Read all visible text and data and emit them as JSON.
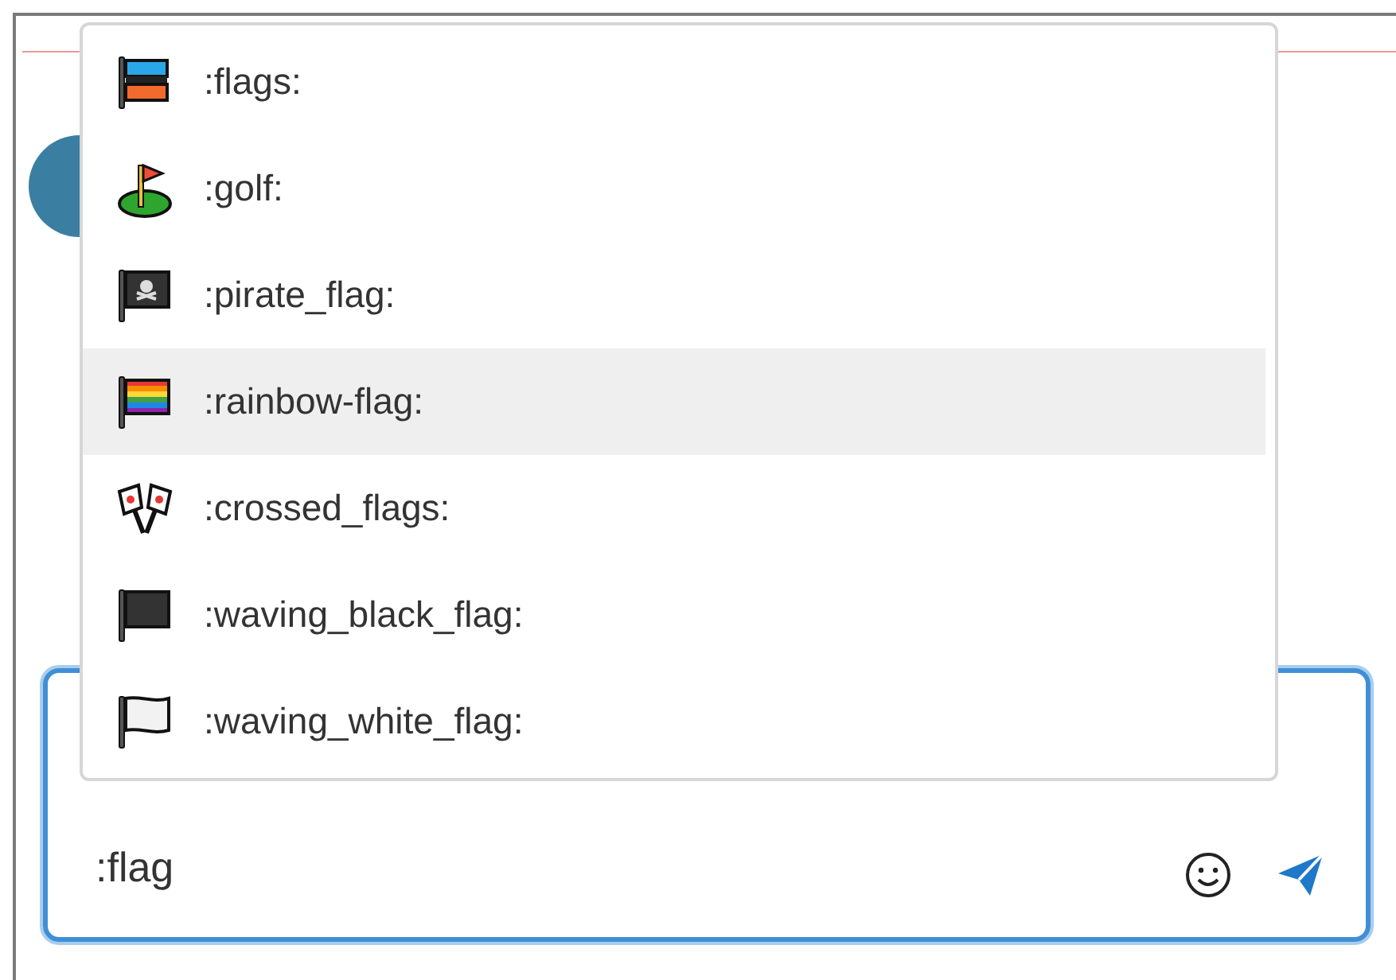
{
  "suggestions": [
    {
      "label": ":flags:",
      "selected": false
    },
    {
      "label": ":golf:",
      "selected": false
    },
    {
      "label": ":pirate_flag:",
      "selected": false
    },
    {
      "label": ":rainbow-flag:",
      "selected": true
    },
    {
      "label": ":crossed_flags:",
      "selected": false
    },
    {
      "label": ":waving_black_flag:",
      "selected": false
    },
    {
      "label": ":waving_white_flag:",
      "selected": false
    }
  ],
  "composer": {
    "value": ":flag"
  }
}
